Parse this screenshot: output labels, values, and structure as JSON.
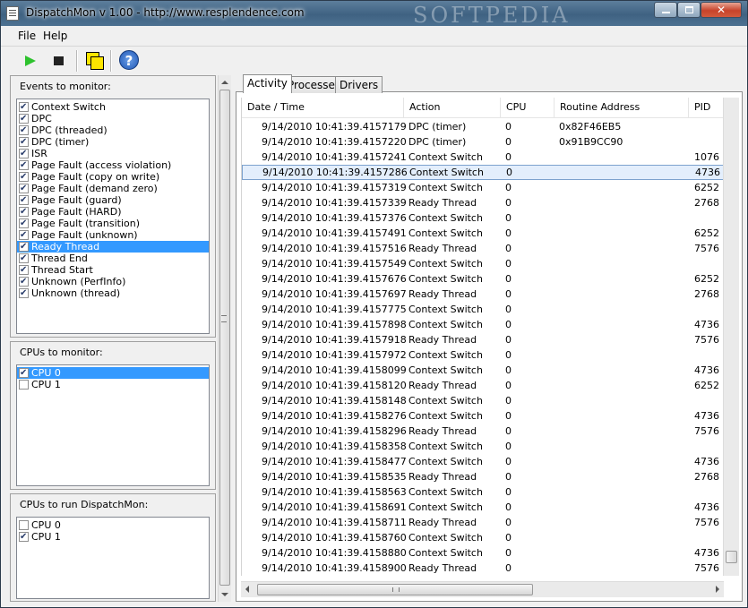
{
  "window": {
    "title": "DispatchMon v 1.00 - http://www.resplendence.com",
    "watermark": "SOFTPEDIA"
  },
  "menu": {
    "file": "File",
    "help": "Help"
  },
  "toolbar": {
    "icons": [
      "play-icon",
      "stop-icon",
      "cpu-select-icon",
      "help-icon"
    ]
  },
  "events": {
    "title": "Events to monitor:",
    "items": [
      {
        "label": "Context Switch",
        "checked": true
      },
      {
        "label": "DPC",
        "checked": true
      },
      {
        "label": "DPC (threaded)",
        "checked": true
      },
      {
        "label": "DPC (timer)",
        "checked": true
      },
      {
        "label": "ISR",
        "checked": true
      },
      {
        "label": "Page Fault (access violation)",
        "checked": true
      },
      {
        "label": "Page Fault (copy on write)",
        "checked": true
      },
      {
        "label": "Page Fault (demand zero)",
        "checked": true
      },
      {
        "label": "Page Fault (guard)",
        "checked": true
      },
      {
        "label": "Page Fault (HARD)",
        "checked": true
      },
      {
        "label": "Page Fault (transition)",
        "checked": true
      },
      {
        "label": "Page Fault (unknown)",
        "checked": true
      },
      {
        "label": "Ready Thread",
        "checked": true,
        "selected": true
      },
      {
        "label": "Thread End",
        "checked": true
      },
      {
        "label": "Thread Start",
        "checked": true
      },
      {
        "label": "Unknown (PerfInfo)",
        "checked": true
      },
      {
        "label": "Unknown (thread)",
        "checked": true
      }
    ]
  },
  "cpus_monitor": {
    "title": "CPUs to monitor:",
    "items": [
      {
        "label": "CPU 0",
        "checked": true,
        "selected": true
      },
      {
        "label": "CPU 1",
        "checked": false
      }
    ]
  },
  "cpus_run": {
    "title": "CPUs to run DispatchMon:",
    "items": [
      {
        "label": "CPU 0",
        "checked": false
      },
      {
        "label": "CPU 1",
        "checked": true
      }
    ]
  },
  "tabs": [
    "Activity",
    "Processes",
    "Drivers"
  ],
  "columns": [
    "Date / Time",
    "Action",
    "CPU",
    "Routine Address",
    "PID"
  ],
  "rows": [
    [
      "9/14/2010 10:41:39.4157179",
      "DPC (timer)",
      "0",
      "0x82F46EB5",
      ""
    ],
    [
      "9/14/2010 10:41:39.4157220",
      "DPC (timer)",
      "0",
      "0x91B9CC90",
      ""
    ],
    [
      "9/14/2010 10:41:39.4157241",
      "Context Switch",
      "0",
      "",
      "1076"
    ],
    [
      "9/14/2010 10:41:39.4157286",
      "Context Switch",
      "0",
      "",
      "4736"
    ],
    [
      "9/14/2010 10:41:39.4157319",
      "Context Switch",
      "0",
      "",
      "6252"
    ],
    [
      "9/14/2010 10:41:39.4157339",
      "Ready Thread",
      "0",
      "",
      "2768"
    ],
    [
      "9/14/2010 10:41:39.4157376",
      "Context Switch",
      "0",
      "",
      ""
    ],
    [
      "9/14/2010 10:41:39.4157491",
      "Context Switch",
      "0",
      "",
      "6252"
    ],
    [
      "9/14/2010 10:41:39.4157516",
      "Ready Thread",
      "0",
      "",
      "7576"
    ],
    [
      "9/14/2010 10:41:39.4157549",
      "Context Switch",
      "0",
      "",
      ""
    ],
    [
      "9/14/2010 10:41:39.4157676",
      "Context Switch",
      "0",
      "",
      "6252"
    ],
    [
      "9/14/2010 10:41:39.4157697",
      "Ready Thread",
      "0",
      "",
      "2768"
    ],
    [
      "9/14/2010 10:41:39.4157775",
      "Context Switch",
      "0",
      "",
      ""
    ],
    [
      "9/14/2010 10:41:39.4157898",
      "Context Switch",
      "0",
      "",
      "4736"
    ],
    [
      "9/14/2010 10:41:39.4157918",
      "Ready Thread",
      "0",
      "",
      "7576"
    ],
    [
      "9/14/2010 10:41:39.4157972",
      "Context Switch",
      "0",
      "",
      ""
    ],
    [
      "9/14/2010 10:41:39.4158099",
      "Context Switch",
      "0",
      "",
      "4736"
    ],
    [
      "9/14/2010 10:41:39.4158120",
      "Ready Thread",
      "0",
      "",
      "6252"
    ],
    [
      "9/14/2010 10:41:39.4158148",
      "Context Switch",
      "0",
      "",
      ""
    ],
    [
      "9/14/2010 10:41:39.4158276",
      "Context Switch",
      "0",
      "",
      "4736"
    ],
    [
      "9/14/2010 10:41:39.4158296",
      "Ready Thread",
      "0",
      "",
      "7576"
    ],
    [
      "9/14/2010 10:41:39.4158358",
      "Context Switch",
      "0",
      "",
      ""
    ],
    [
      "9/14/2010 10:41:39.4158477",
      "Context Switch",
      "0",
      "",
      "4736"
    ],
    [
      "9/14/2010 10:41:39.4158535",
      "Ready Thread",
      "0",
      "",
      "2768"
    ],
    [
      "9/14/2010 10:41:39.4158563",
      "Context Switch",
      "0",
      "",
      ""
    ],
    [
      "9/14/2010 10:41:39.4158691",
      "Context Switch",
      "0",
      "",
      "4736"
    ],
    [
      "9/14/2010 10:41:39.4158711",
      "Ready Thread",
      "0",
      "",
      "7576"
    ],
    [
      "9/14/2010 10:41:39.4158760",
      "Context Switch",
      "0",
      "",
      ""
    ],
    [
      "9/14/2010 10:41:39.4158880",
      "Context Switch",
      "0",
      "",
      "4736"
    ],
    [
      "9/14/2010 10:41:39.4158900",
      "Ready Thread",
      "0",
      "",
      "7576"
    ]
  ],
  "selected_row": 3,
  "colors": {
    "selection": "#3399ff",
    "row_selection": "#e3eefc",
    "play": "#2ec22e"
  }
}
